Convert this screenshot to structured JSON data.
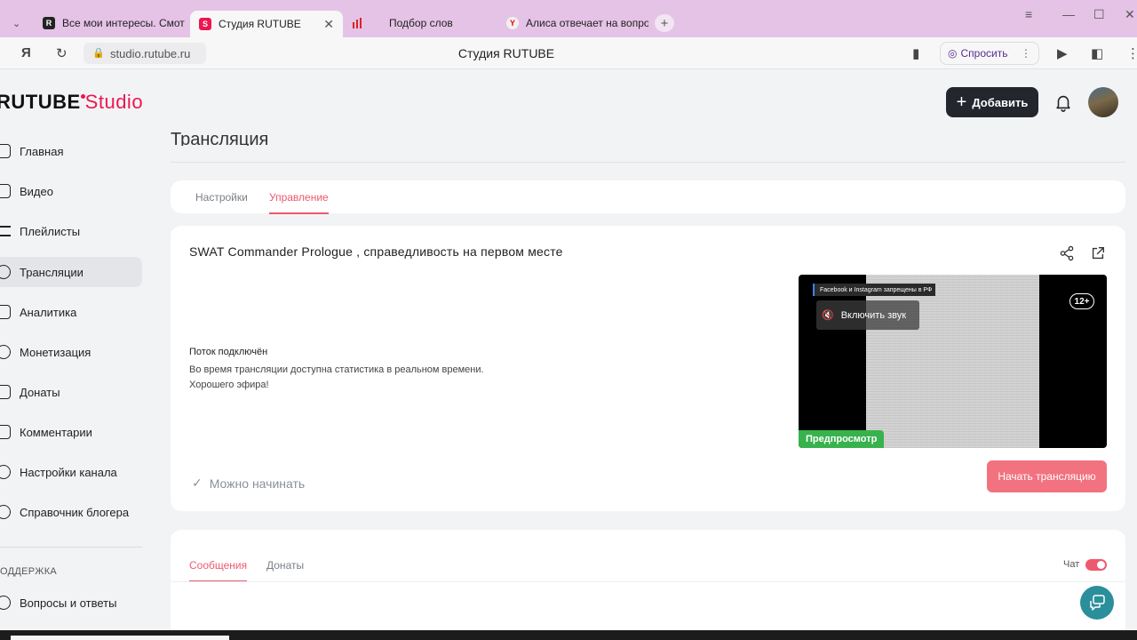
{
  "browser": {
    "tabs": [
      {
        "label": "Все мои интересы. Смотр",
        "active": false
      },
      {
        "label": "Студия RUTUBE",
        "active": true
      },
      {
        "label": "Подбор слов",
        "active": false
      },
      {
        "label": "Алиса отвечает на вопро",
        "active": false
      }
    ],
    "url": "studio.rutube.ru",
    "page_title": "Студия RUTUBE",
    "ask_label": "Спросить"
  },
  "header": {
    "logo_main": "RUTUBE",
    "logo_accent": "Studio",
    "add_label": "Добавить"
  },
  "sidebar": {
    "items": [
      {
        "label": "Главная",
        "icon": "home-icon"
      },
      {
        "label": "Видео",
        "icon": "video-icon"
      },
      {
        "label": "Плейлисты",
        "icon": "playlist-icon"
      },
      {
        "label": "Трансляции",
        "icon": "broadcast-icon",
        "active": true
      },
      {
        "label": "Аналитика",
        "icon": "analytics-icon"
      },
      {
        "label": "Монетизация",
        "icon": "ruble-icon"
      },
      {
        "label": "Донаты",
        "icon": "wallet-icon"
      },
      {
        "label": "Комментарии",
        "icon": "comment-icon"
      },
      {
        "label": "Настройки канала",
        "icon": "gear-icon"
      },
      {
        "label": "Справочник блогера",
        "icon": "info-icon"
      }
    ],
    "support_label": "ОДДЕРЖКА",
    "support_items": [
      {
        "label": "Вопросы и ответы",
        "icon": "question-icon"
      }
    ]
  },
  "page": {
    "heading": "Трансляция",
    "tabs": [
      {
        "label": "Настройки",
        "active": false
      },
      {
        "label": "Управление",
        "active": true
      }
    ]
  },
  "stream": {
    "title": "SWAT Commander Prologue , справедливость на первом месте",
    "status_title": "Поток подключён",
    "status_line1": "Во время трансляции доступна статистика в реальном времени.",
    "status_line2": "Хорошего эфира!",
    "ready_label": "Можно начинать",
    "start_label": "Начать трансляцию",
    "preview": {
      "notice": "Facebook и Instagram запрещены в РФ",
      "sound_label": "Включить звук",
      "age_rating": "12+",
      "badge": "Предпросмотр"
    }
  },
  "chat": {
    "tabs": [
      {
        "label": "Сообщения",
        "active": true
      },
      {
        "label": "Донаты",
        "active": false
      }
    ],
    "toggle_label": "Чат",
    "toggle_on": true
  },
  "colors": {
    "accent": "#ed5a6f",
    "brand": "#ed1651",
    "tabbar": "#e5c3e6",
    "preview_badge": "#37b24d",
    "help_fab": "#2a8f9a"
  }
}
